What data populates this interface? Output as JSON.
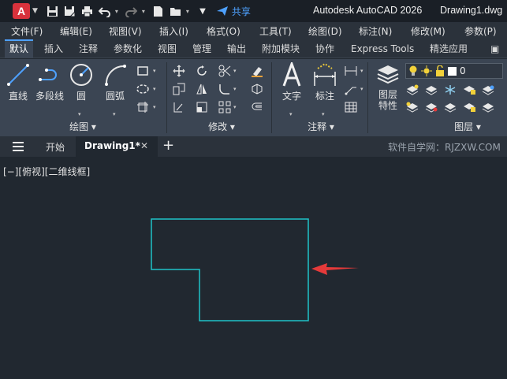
{
  "titlebar": {
    "logo_letter": "A",
    "share_label": "共享",
    "app_title": "Autodesk AutoCAD 2026",
    "file_title": "Drawing1.dwg",
    "quick_access_icons": [
      "save-icon",
      "save-as-icon",
      "print-icon",
      "undo-icon",
      "redo-icon",
      "new-icon",
      "open-icon"
    ]
  },
  "menubar": {
    "items": [
      "文件(F)",
      "编辑(E)",
      "视图(V)",
      "插入(I)",
      "格式(O)",
      "工具(T)",
      "绘图(D)",
      "标注(N)",
      "修改(M)",
      "参数(P)"
    ]
  },
  "ribbon_tabs": {
    "items": [
      "默认",
      "插入",
      "注释",
      "参数化",
      "视图",
      "管理",
      "输出",
      "附加模块",
      "协作",
      "Express Tools",
      "精选应用"
    ],
    "active": "默认"
  },
  "ribbon": {
    "draw": {
      "title": "绘图",
      "line": "直线",
      "polyline": "多段线",
      "circle": "圆",
      "arc": "圆弧"
    },
    "modify": {
      "title": "修改"
    },
    "annotation": {
      "title": "注释",
      "text": "文字",
      "dimension": "标注"
    },
    "layers": {
      "title": "图层",
      "layer_properties": "图层\n特性",
      "layer_properties_line1": "图层",
      "layer_properties_line2": "特性",
      "current_layer": "0"
    }
  },
  "file_tabs": {
    "start": "开始",
    "drawing": "Drawing1*",
    "watermark": "软件自学网：RJZXW.COM"
  },
  "canvas": {
    "viewport_label": "[−][俯视][二维线框]",
    "shape_color": "#1fc3c8",
    "arrow_color": "#e53a3a"
  },
  "colors": {
    "accent": "#4ea1ff",
    "background": "#212830",
    "ribbon": "#3b4553"
  }
}
